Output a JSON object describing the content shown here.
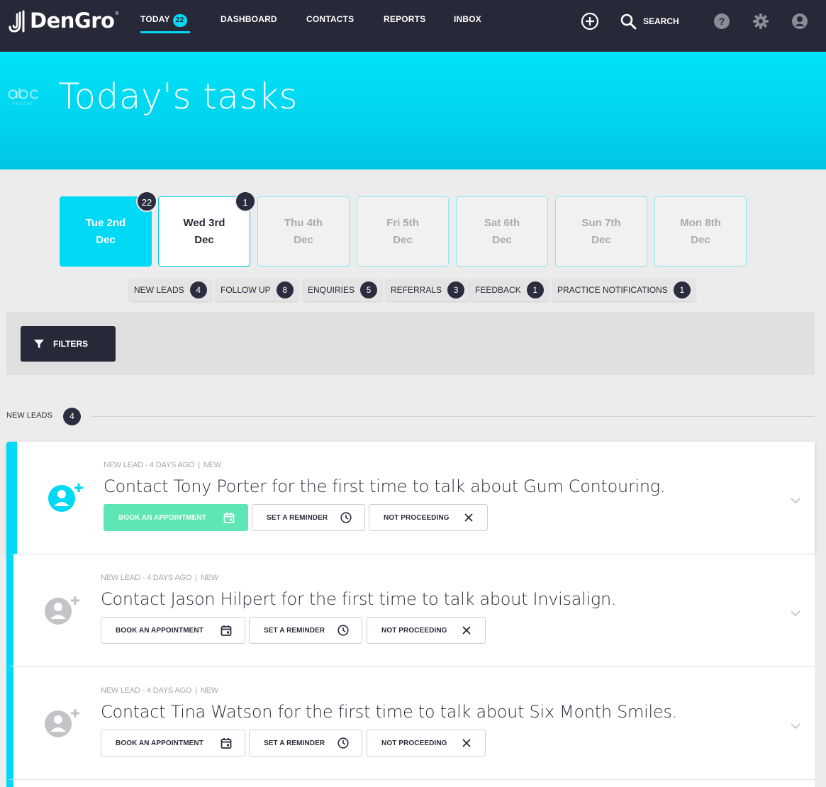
{
  "app": {
    "brand": "DenGro",
    "trademark": "®"
  },
  "nav": {
    "items": [
      {
        "label": "TODAY",
        "badge": "22"
      },
      {
        "label": "DASHBOARD"
      },
      {
        "label": "CONTACTS"
      },
      {
        "label": "REPORTS"
      },
      {
        "label": "INBOX"
      }
    ],
    "search_label": "SEARCH",
    "icons": [
      "add-circle-icon",
      "search-icon",
      "help-icon",
      "settings-icon",
      "account-icon"
    ]
  },
  "hero": {
    "title": "Today's tasks",
    "practice_logo": "abc dental"
  },
  "days": [
    {
      "line1": "Tue 2nd",
      "line2": "Dec",
      "badge": "22",
      "state": "active"
    },
    {
      "line1": "Wed 3rd",
      "line2": "Dec",
      "badge": "1",
      "state": "selected"
    },
    {
      "line1": "Thu 4th",
      "line2": "Dec",
      "state": "inactive"
    },
    {
      "line1": "Fri 5th",
      "line2": "Dec",
      "state": "inactive"
    },
    {
      "line1": "Sat 6th",
      "line2": "Dec",
      "state": "inactive"
    },
    {
      "line1": "Sun 7th",
      "line2": "Dec",
      "state": "inactive"
    },
    {
      "line1": "Mon 8th",
      "line2": "Dec",
      "state": "inactive"
    }
  ],
  "categories": [
    {
      "label": "NEW LEADS",
      "count": "4"
    },
    {
      "label": "FOLLOW UP",
      "count": "8"
    },
    {
      "label": "ENQUIRIES",
      "count": "5"
    },
    {
      "label": "REFERRALS",
      "count": "3"
    },
    {
      "label": "FEEDBACK",
      "count": "1"
    },
    {
      "label": "PRACTICE NOTIFICATIONS",
      "count": "1"
    }
  ],
  "filters": {
    "label": "FILTERS"
  },
  "section": {
    "label": "NEW LEADS",
    "count": "4"
  },
  "tasks": [
    {
      "meta_type": "NEW LEAD - 4 DAYS AGO",
      "meta_status": "NEW",
      "title": "Contact Tony Porter for the first time to talk about Gum Contouring.",
      "book_label": "BOOK AN APPOINTMENT",
      "reminder_label": "SET A REMINDER",
      "not_proceeding_label": "NOT PROCEEDING"
    },
    {
      "meta_type": "NEW LEAD - 4 DAYS AGO",
      "meta_status": "NEW",
      "title": "Contact Jason Hilpert for the first time to talk about Invisalign.",
      "book_label": "BOOK AN APPOINTMENT",
      "reminder_label": "SET A REMINDER",
      "not_proceeding_label": "NOT PROCEEDING"
    },
    {
      "meta_type": "NEW LEAD - 4 DAYS AGO",
      "meta_status": "NEW",
      "title": "Contact Tina Watson for the first time to talk about Six Month Smiles.",
      "book_label": "BOOK AN APPOINTMENT",
      "reminder_label": "SET A REMINDER",
      "not_proceeding_label": "NOT PROCEEDING"
    }
  ],
  "colors": {
    "nav_bg": "#272838",
    "accent": "#00d9f5",
    "badge_bg": "#2b2c3e",
    "book_green": "#5ee6b4"
  }
}
